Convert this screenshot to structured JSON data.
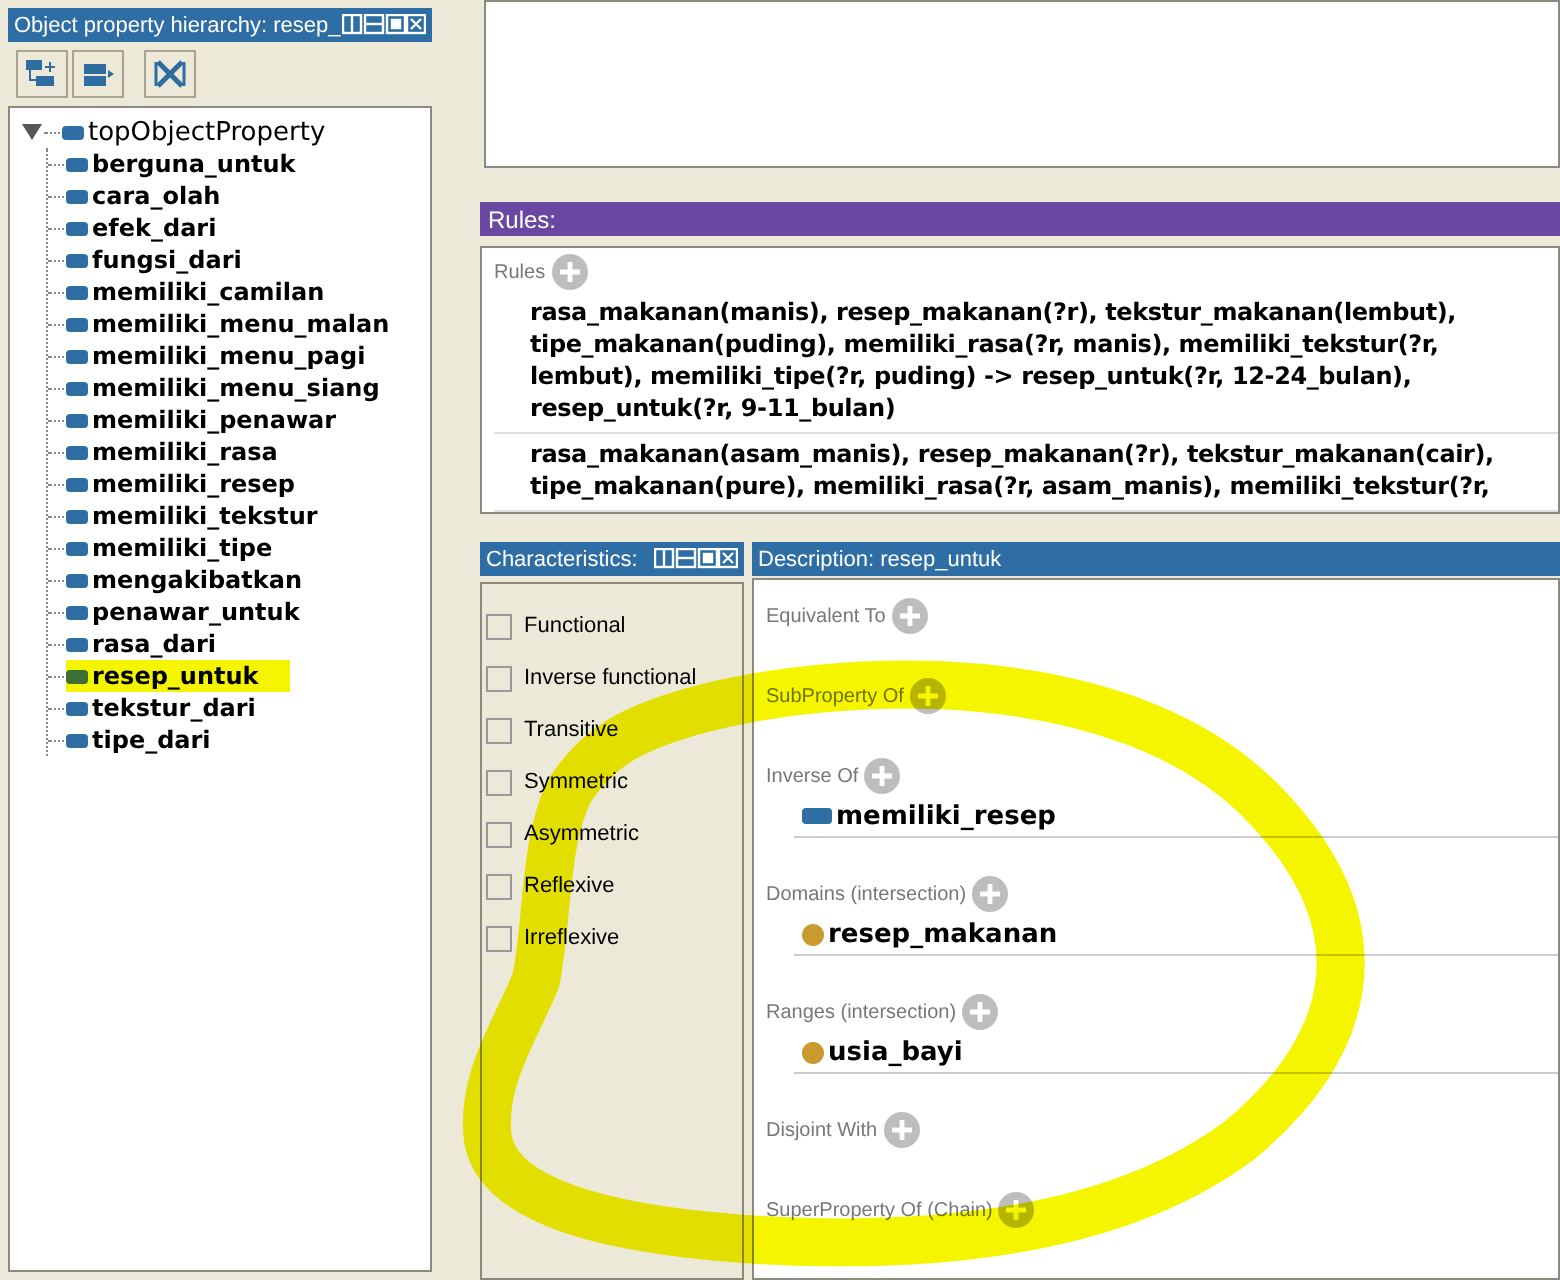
{
  "hierarchy": {
    "title": "Object property hierarchy: resep_",
    "root": {
      "label": "topObjectProperty",
      "expanded": true,
      "children": [
        {
          "label": "berguna_untuk",
          "selected": false
        },
        {
          "label": "cara_olah",
          "selected": false
        },
        {
          "label": "efek_dari",
          "selected": false
        },
        {
          "label": "fungsi_dari",
          "selected": false
        },
        {
          "label": "memiliki_camilan",
          "selected": false
        },
        {
          "label": "memiliki_menu_malan",
          "selected": false
        },
        {
          "label": "memiliki_menu_pagi",
          "selected": false
        },
        {
          "label": "memiliki_menu_siang",
          "selected": false
        },
        {
          "label": "memiliki_penawar",
          "selected": false
        },
        {
          "label": "memiliki_rasa",
          "selected": false
        },
        {
          "label": "memiliki_resep",
          "selected": false
        },
        {
          "label": "memiliki_tekstur",
          "selected": false
        },
        {
          "label": "memiliki_tipe",
          "selected": false
        },
        {
          "label": "mengakibatkan",
          "selected": false
        },
        {
          "label": "penawar_untuk",
          "selected": false
        },
        {
          "label": "rasa_dari",
          "selected": false
        },
        {
          "label": "resep_untuk",
          "selected": true
        },
        {
          "label": "tekstur_dari",
          "selected": false
        },
        {
          "label": "tipe_dari",
          "selected": false
        }
      ]
    }
  },
  "rules": {
    "title": "Rules:",
    "section_label": "Rules",
    "items": [
      "rasa_makanan(manis), resep_makanan(?r), tekstur_makanan(lembut), tipe_makanan(puding), memiliki_rasa(?r, manis), memiliki_tekstur(?r, lembut), memiliki_tipe(?r, puding) -> resep_untuk(?r, 12-24_bulan), resep_untuk(?r, 9-11_bulan)",
      "rasa_makanan(asam_manis), resep_makanan(?r), tekstur_makanan(cair), tipe_makanan(pure), memiliki_rasa(?r, asam_manis), memiliki_tekstur(?r,"
    ]
  },
  "characteristics": {
    "title": "Characteristics:",
    "items": [
      {
        "label": "Functional",
        "checked": false
      },
      {
        "label": "Inverse functional",
        "checked": false
      },
      {
        "label": "Transitive",
        "checked": false
      },
      {
        "label": "Symmetric",
        "checked": false
      },
      {
        "label": "Asymmetric",
        "checked": false
      },
      {
        "label": "Reflexive",
        "checked": false
      },
      {
        "label": "Irreflexive",
        "checked": false
      }
    ]
  },
  "description": {
    "title": "Description: resep_untuk",
    "sections": [
      {
        "label": "Equivalent To"
      },
      {
        "label": "SubProperty Of"
      },
      {
        "label": "Inverse Of",
        "entries": [
          {
            "label": "memiliki_resep",
            "kind": "property"
          }
        ]
      },
      {
        "label": "Domains (intersection)",
        "entries": [
          {
            "label": "resep_makanan",
            "kind": "class"
          }
        ]
      },
      {
        "label": "Ranges (intersection)",
        "entries": [
          {
            "label": "usia_bayi",
            "kind": "class"
          }
        ]
      },
      {
        "label": "Disjoint With"
      },
      {
        "label": "SuperProperty Of (Chain)"
      }
    ]
  }
}
